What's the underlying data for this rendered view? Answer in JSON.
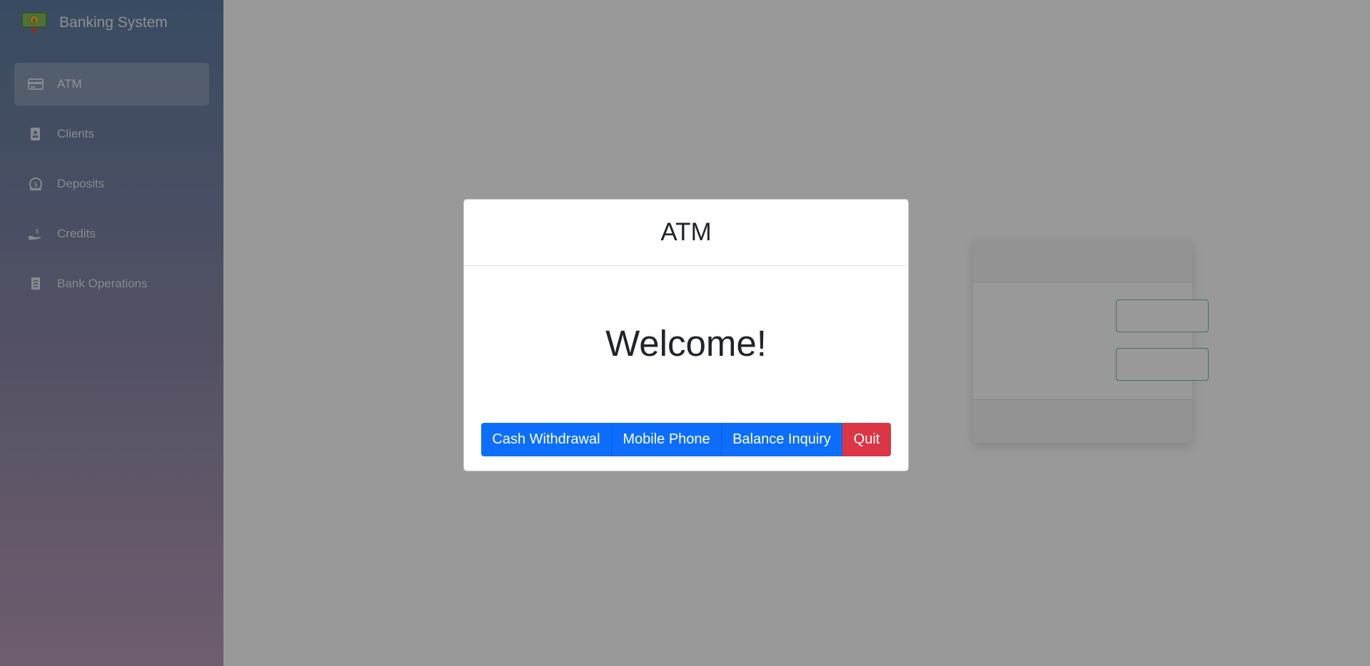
{
  "app": {
    "title": "Banking System",
    "logo_icon": "money-bill-icon"
  },
  "sidebar": {
    "items": [
      {
        "label": "ATM",
        "icon": "credit-card-icon",
        "active": true
      },
      {
        "label": "Clients",
        "icon": "address-book-icon",
        "active": false
      },
      {
        "label": "Deposits",
        "icon": "piggy-bank-icon",
        "active": false
      },
      {
        "label": "Credits",
        "icon": "hand-holding-dollar-icon",
        "active": false
      },
      {
        "label": "Bank Operations",
        "icon": "receipt-icon",
        "active": false
      }
    ]
  },
  "modal": {
    "title": "ATM",
    "message": "Welcome!",
    "buttons": {
      "cash_withdrawal": "Cash Withdrawal",
      "mobile_phone": "Mobile Phone",
      "balance_inquiry": "Balance Inquiry",
      "quit": "Quit"
    }
  },
  "colors": {
    "primary": "#0d6efd",
    "danger": "#dc3545",
    "input_border": "#62c2a5"
  }
}
